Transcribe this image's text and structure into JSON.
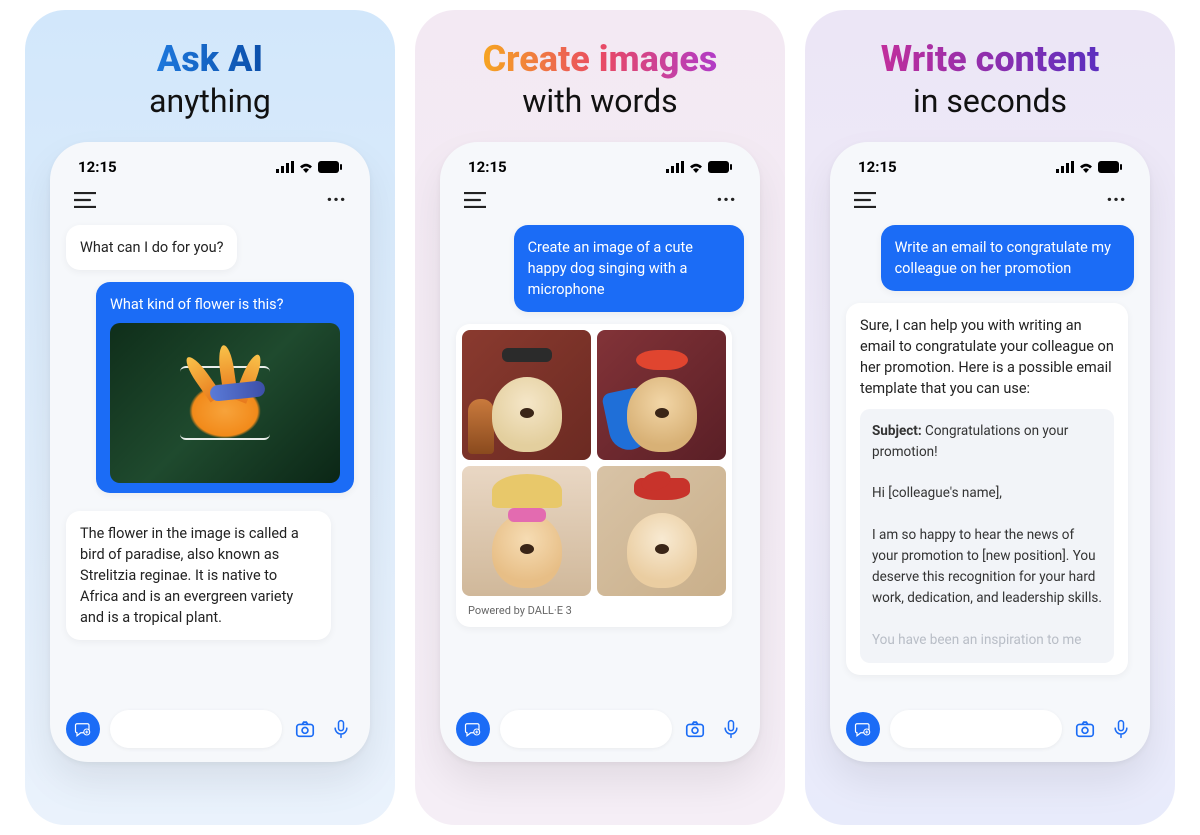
{
  "panels": [
    {
      "headline1": "Ask AI",
      "headline2": "anything",
      "status_time": "12:15",
      "ai_greeting": "What can I do for you?",
      "user_prompt": "What kind of flower is this?",
      "ai_response": "The flower in the image is called a bird of paradise, also known as Strelitzia reginae. It is native to Africa and is an evergreen variety and is a tropical plant."
    },
    {
      "headline1": "Create images",
      "headline2": "with words",
      "status_time": "12:15",
      "user_prompt": "Create an image of a cute happy dog singing with a microphone",
      "powered_by": "Powered by DALL·E 3"
    },
    {
      "headline1": "Write content",
      "headline2": "in seconds",
      "status_time": "12:15",
      "user_prompt": "Write an email to congratulate my colleague on her promotion",
      "ai_response_intro": "Sure, I can help you with writing an email to congratulate your colleague on her promotion. Here is a possible email template that you can use:",
      "email_subject_label": "Subject:",
      "email_subject": "Congratulations on your promotion!",
      "email_greeting": "Hi [colleague's name],",
      "email_body1": "I am so happy to hear the news of your promotion to [new position]. You deserve this recognition for your hard work, dedication, and leadership skills.",
      "email_body2": "You have been an inspiration to me"
    }
  ]
}
